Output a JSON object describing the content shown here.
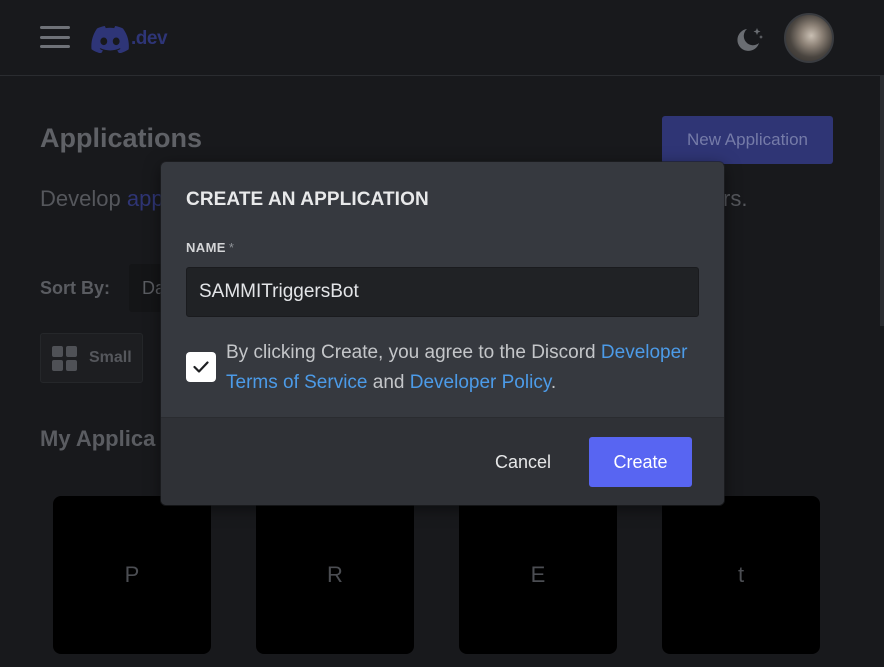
{
  "header": {
    "logo_text": ".dev",
    "menu_icon": "hamburger-menu-icon",
    "theme_icon": "moon-stars-icon",
    "avatar_icon": "user-avatar"
  },
  "page": {
    "title": "Applications",
    "new_app_label": "New Application",
    "subtitle_start": "Develop ",
    "subtitle_link": "app",
    "subtitle_end": "rs.",
    "sort_label": "Sort By:",
    "sort_value": "Da",
    "view_label": "Small",
    "section_title": "My Applica",
    "cards": [
      "P",
      "R",
      "E",
      "t"
    ]
  },
  "modal": {
    "title": "CREATE AN APPLICATION",
    "name_label": "NAME",
    "required_marker": "*",
    "name_value": "SAMMITriggersBot",
    "agree_prefix": "By clicking Create, you agree to the Discord ",
    "agree_link1": "Developer Terms of Service",
    "agree_mid": " and ",
    "agree_link2": "Developer Policy",
    "agree_suffix": ".",
    "checkbox_checked": true,
    "cancel_label": "Cancel",
    "create_label": "Create"
  },
  "colors": {
    "background": "#18191c",
    "modal": "#36393f",
    "modal_footer": "#2f3136",
    "blurple": "#5865f2",
    "link": "#4c9be8"
  }
}
